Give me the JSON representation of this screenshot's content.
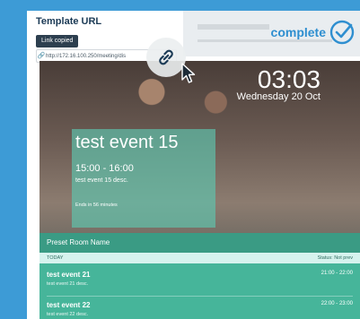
{
  "panel": {
    "title": "Template URL",
    "copied_label": "Link copied",
    "url": "http://172.16.100.250/meeting/dis"
  },
  "status": {
    "label": "complete",
    "icon": "check-circle-icon"
  },
  "screen": {
    "time": "03:03",
    "date": "Wednesday 20 Oct",
    "current_event": {
      "title": "test event 15",
      "time": "15:00 - 16:00",
      "desc": "test event 15 desc.",
      "ends": "Ends in 56 minutes"
    },
    "room_name": "Preset Room Name",
    "today_label": "TODAY",
    "status_label": "Status: Not prev",
    "events": [
      {
        "title": "test event 21",
        "desc": "test event 21 desc.",
        "time": "21:00 - 22:00"
      },
      {
        "title": "test event 22",
        "desc": "test event 22 desc.",
        "time": "22:00 - 23:00"
      }
    ]
  },
  "colors": {
    "background": "#3d9bd6",
    "accent": "#2f8fd0",
    "teal": "#46b59a"
  }
}
